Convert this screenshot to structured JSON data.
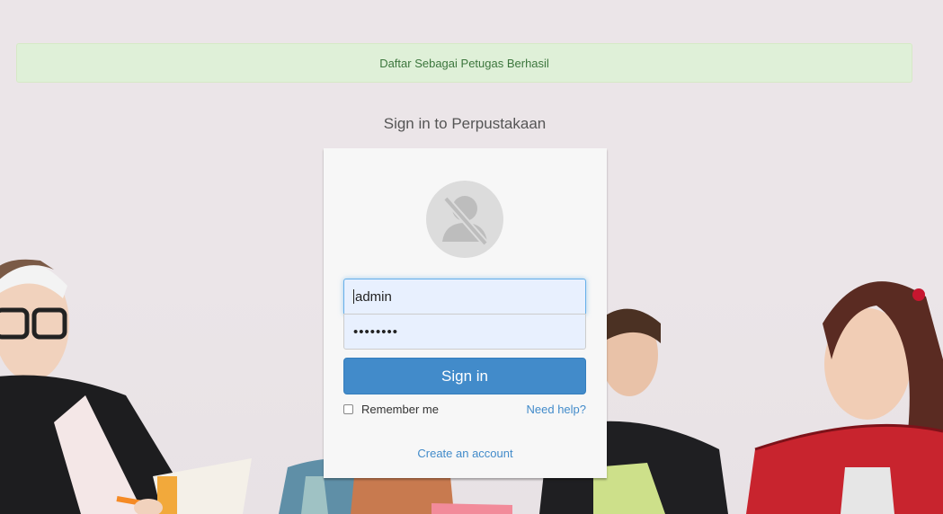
{
  "alert": {
    "message": "Daftar Sebagai Petugas Berhasil"
  },
  "heading": "Sign in to Perpustakaan",
  "login": {
    "username_value": "admin",
    "password_value": "••••••••",
    "sign_in_label": "Sign in",
    "remember_label": "Remember me",
    "help_label": "Need help?",
    "create_account_label": "Create an account"
  },
  "colors": {
    "alert_bg": "#dff0d8",
    "alert_text": "#3c763d",
    "primary": "#428bca"
  },
  "icons": {
    "avatar": "user-slash-icon",
    "remember": "checkbox-icon"
  }
}
